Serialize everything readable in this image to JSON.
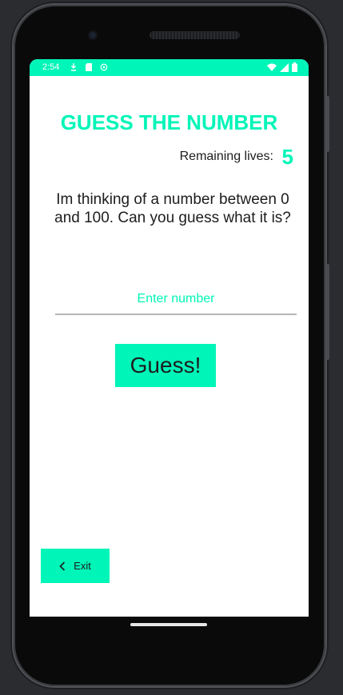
{
  "status_bar": {
    "time": "2:54",
    "left_icons": [
      "download-icon",
      "sd-card-icon",
      "app-notification-icon"
    ],
    "right_icons": [
      "wifi-icon",
      "signal-icon",
      "battery-icon"
    ],
    "color": "#00f5b8"
  },
  "game": {
    "title": "GUESS THE NUMBER",
    "lives_label": "Remaining lives:",
    "lives_value": "5",
    "prompt": "Im thinking of a number between 0 and 100. Can you guess what it is?",
    "input_placeholder": "Enter number",
    "input_value": "",
    "guess_label": "Guess!",
    "exit_label": "Exit",
    "exit_icon": "chevron-left-icon"
  },
  "colors": {
    "accent": "#00f5b8",
    "text": "#1d1d1d",
    "background": "#ffffff"
  }
}
